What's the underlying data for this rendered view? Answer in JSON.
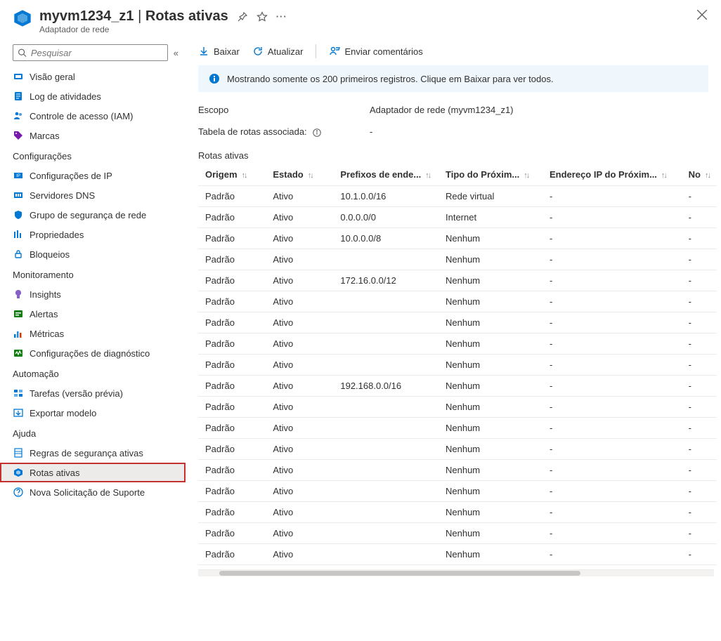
{
  "header": {
    "resource_name": "myvm1234_z1",
    "page_name": "Rotas ativas",
    "subtitle": "Adaptador de rede"
  },
  "sidebar": {
    "search_placeholder": "Pesquisar",
    "top_items": [
      {
        "label": "Visão geral",
        "icon": "network-icon",
        "color": "#0078d4"
      },
      {
        "label": "Log de atividades",
        "icon": "log-icon",
        "color": "#0078d4"
      },
      {
        "label": "Controle de acesso (IAM)",
        "icon": "people-icon",
        "color": "#0078d4"
      },
      {
        "label": "Marcas",
        "icon": "tag-icon",
        "color": "#7719aa"
      }
    ],
    "sections": [
      {
        "title": "Configurações",
        "items": [
          {
            "label": "Configurações de IP",
            "icon": "ip-icon",
            "color": "#0078d4"
          },
          {
            "label": "Servidores DNS",
            "icon": "dns-icon",
            "color": "#0078d4"
          },
          {
            "label": "Grupo de segurança de rede",
            "icon": "shield-icon",
            "color": "#0078d4"
          },
          {
            "label": "Propriedades",
            "icon": "properties-icon",
            "color": "#0078d4"
          },
          {
            "label": "Bloqueios",
            "icon": "lock-icon",
            "color": "#0078d4"
          }
        ]
      },
      {
        "title": "Monitoramento",
        "items": [
          {
            "label": "Insights",
            "icon": "bulb-icon",
            "color": "#8661c5"
          },
          {
            "label": "Alertas",
            "icon": "alerts-icon",
            "color": "#107c10"
          },
          {
            "label": "Métricas",
            "icon": "metrics-icon",
            "color": "#0078d4"
          },
          {
            "label": "Configurações de diagnóstico",
            "icon": "diagnostic-icon",
            "color": "#107c10"
          }
        ]
      },
      {
        "title": "Automação",
        "items": [
          {
            "label": "Tarefas (versão prévia)",
            "icon": "tasks-icon",
            "color": "#0078d4"
          },
          {
            "label": "Exportar modelo",
            "icon": "export-icon",
            "color": "#0078d4"
          }
        ]
      },
      {
        "title": "Ajuda",
        "items": [
          {
            "label": "Regras de segurança ativas",
            "icon": "rules-icon",
            "color": "#0078d4"
          },
          {
            "label": "Rotas ativas",
            "icon": "routes-icon",
            "color": "#0078d4",
            "active": true
          },
          {
            "label": "Nova Solicitação de Suporte",
            "icon": "support-icon",
            "color": "#0078d4"
          }
        ]
      }
    ]
  },
  "toolbar": {
    "download": "Baixar",
    "refresh": "Atualizar",
    "feedback": "Enviar comentários"
  },
  "info_banner": "Mostrando somente os 200 primeiros registros. Clique em Baixar para ver todos.",
  "scope_row": {
    "label": "Escopo",
    "value": "Adaptador de rede (myvm1234_z1)"
  },
  "route_table_row": {
    "label": "Tabela de rotas associada:",
    "value": "-"
  },
  "routes_title": "Rotas ativas",
  "table": {
    "columns": [
      "Origem",
      "Estado",
      "Prefixos de ende...",
      "Tipo do Próxim...",
      "Endereço IP do Próxim...",
      "No"
    ],
    "rows": [
      {
        "origin": "Padrão",
        "state": "Ativo",
        "prefix": "10.1.0.0/16",
        "hop_type": "Rede virtual",
        "hop_ip": "-",
        "extra": "-"
      },
      {
        "origin": "Padrão",
        "state": "Ativo",
        "prefix": "0.0.0.0/0",
        "hop_type": "Internet",
        "hop_ip": "-",
        "extra": "-"
      },
      {
        "origin": "Padrão",
        "state": "Ativo",
        "prefix": "10.0.0.0/8",
        "hop_type": "Nenhum",
        "hop_ip": "-",
        "extra": "-"
      },
      {
        "origin": "Padrão",
        "state": "Ativo",
        "prefix": "",
        "hop_type": "Nenhum",
        "hop_ip": "-",
        "extra": "-"
      },
      {
        "origin": "Padrão",
        "state": "Ativo",
        "prefix": "172.16.0.0/12",
        "hop_type": "Nenhum",
        "hop_ip": "-",
        "extra": "-"
      },
      {
        "origin": "Padrão",
        "state": "Ativo",
        "prefix": "",
        "hop_type": "Nenhum",
        "hop_ip": "-",
        "extra": "-"
      },
      {
        "origin": "Padrão",
        "state": "Ativo",
        "prefix": "",
        "hop_type": "Nenhum",
        "hop_ip": "-",
        "extra": "-"
      },
      {
        "origin": "Padrão",
        "state": "Ativo",
        "prefix": "",
        "hop_type": "Nenhum",
        "hop_ip": "-",
        "extra": "-"
      },
      {
        "origin": "Padrão",
        "state": "Ativo",
        "prefix": "",
        "hop_type": "Nenhum",
        "hop_ip": "-",
        "extra": "-"
      },
      {
        "origin": "Padrão",
        "state": "Ativo",
        "prefix": "192.168.0.0/16",
        "hop_type": "Nenhum",
        "hop_ip": "-",
        "extra": "-"
      },
      {
        "origin": "Padrão",
        "state": "Ativo",
        "prefix": "",
        "hop_type": "Nenhum",
        "hop_ip": "-",
        "extra": "-"
      },
      {
        "origin": "Padrão",
        "state": "Ativo",
        "prefix": "",
        "hop_type": "Nenhum",
        "hop_ip": "-",
        "extra": "-"
      },
      {
        "origin": "Padrão",
        "state": "Ativo",
        "prefix": "",
        "hop_type": "Nenhum",
        "hop_ip": "-",
        "extra": "-"
      },
      {
        "origin": "Padrão",
        "state": "Ativo",
        "prefix": "",
        "hop_type": "Nenhum",
        "hop_ip": "-",
        "extra": "-"
      },
      {
        "origin": "Padrão",
        "state": "Ativo",
        "prefix": "",
        "hop_type": "Nenhum",
        "hop_ip": "-",
        "extra": "-"
      },
      {
        "origin": "Padrão",
        "state": "Ativo",
        "prefix": "",
        "hop_type": "Nenhum",
        "hop_ip": "-",
        "extra": "-"
      },
      {
        "origin": "Padrão",
        "state": "Ativo",
        "prefix": "",
        "hop_type": "Nenhum",
        "hop_ip": "-",
        "extra": "-"
      },
      {
        "origin": "Padrão",
        "state": "Ativo",
        "prefix": "",
        "hop_type": "Nenhum",
        "hop_ip": "-",
        "extra": "-"
      }
    ]
  }
}
